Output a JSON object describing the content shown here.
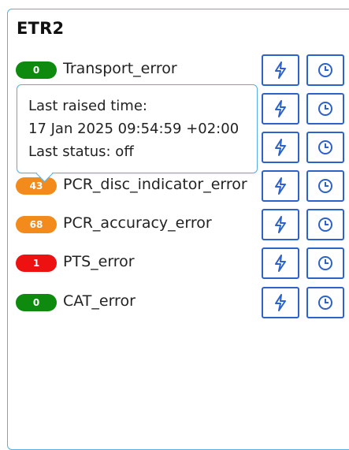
{
  "panel": {
    "title": "ETR2"
  },
  "colors": {
    "ok": "#0e8a0e",
    "warn": "#f28a1c",
    "error": "#ee1111",
    "button_border": "#2d62c9",
    "panel_border": "#5aaee8"
  },
  "rows": [
    {
      "count": "0",
      "label": "Transport_error",
      "status": "ok"
    },
    {
      "count": "",
      "label": "",
      "status": "hidden"
    },
    {
      "count": "",
      "label": "",
      "status": "hidden"
    },
    {
      "count": "43",
      "label": "PCR_disc_indicator_error",
      "status": "warn"
    },
    {
      "count": "68",
      "label": "PCR_accuracy_error",
      "status": "warn"
    },
    {
      "count": "1",
      "label": "PTS_error",
      "status": "error"
    },
    {
      "count": "0",
      "label": "CAT_error",
      "status": "ok"
    }
  ],
  "icons": {
    "trigger": "lightning-icon",
    "history": "clock-icon"
  },
  "tooltip": {
    "line1": "Last raised time:",
    "line2": "17 Jan 2025 09:54:59 +02:00",
    "line3": "Last status: off"
  }
}
